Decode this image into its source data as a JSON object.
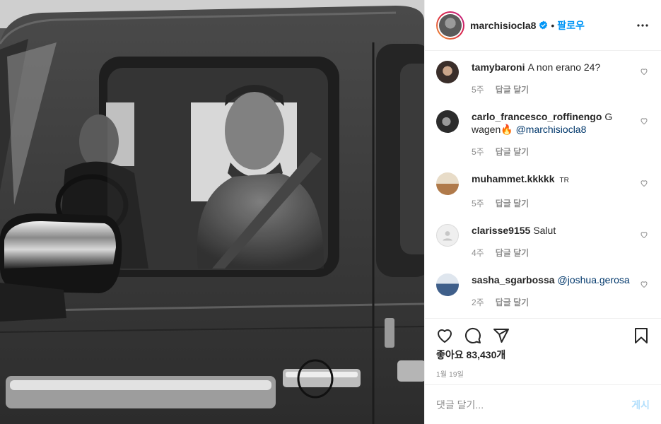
{
  "colors": {
    "accent": "#0095f6",
    "secondary_text": "#8e8e8e",
    "mention": "#00376b",
    "divider": "#efefef"
  },
  "photo": {
    "alt_icon": "grayscale-car-photo"
  },
  "header": {
    "username": "marchisiocla8",
    "verified_icon": "verified-badge-icon",
    "separator": "•",
    "follow_label": "팔로우",
    "more_icon": "more-options-icon"
  },
  "comments": [
    {
      "user": "tamybaroni",
      "text": "A non erano 24?",
      "mention": "",
      "age": "5주",
      "reply_label": "답글 달기"
    },
    {
      "user": "carlo_francesco_roffinengo",
      "text": "G wagen🔥",
      "mention": "@marchisiocla8",
      "age": "5주",
      "reply_label": "답글 달기"
    },
    {
      "user": "muhammet.kkkkk",
      "text": "TR",
      "mention": "",
      "age": "5주",
      "reply_label": "답글 달기"
    },
    {
      "user": "clarisse9155",
      "text": "Salut",
      "mention": "",
      "age": "4주",
      "reply_label": "답글 달기"
    },
    {
      "user": "sasha_sgarbossa",
      "text": "",
      "mention": "@joshua.gerosa",
      "age": "2주",
      "reply_label": "답글 달기"
    }
  ],
  "actions": {
    "like_icon": "heart-icon",
    "comment_icon": "comment-icon",
    "share_icon": "share-icon",
    "save_icon": "bookmark-icon"
  },
  "likes": {
    "label": "좋아요",
    "count": "83,430개"
  },
  "date": "1월 19일",
  "composer": {
    "placeholder": "댓글 달기...",
    "post_label": "게시"
  }
}
